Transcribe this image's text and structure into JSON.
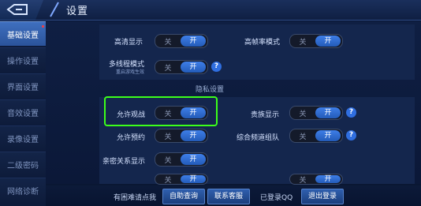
{
  "header": {
    "title": "设置"
  },
  "sidebar": {
    "items": [
      {
        "label": "基础设置",
        "active": true
      },
      {
        "label": "操作设置"
      },
      {
        "label": "界面设置"
      },
      {
        "label": "音效设置"
      },
      {
        "label": "录像设置"
      },
      {
        "label": "二级密码"
      },
      {
        "label": "网络诊断"
      }
    ]
  },
  "display": {
    "hd": {
      "label": "高清显示",
      "off": "关",
      "on": "开"
    },
    "hfr": {
      "label": "高帧率模式",
      "off": "关",
      "on": "开"
    },
    "multithread": {
      "label": "多线程模式",
      "sublabel": "重启游戏生效",
      "off": "关",
      "on": "开",
      "help": "?"
    }
  },
  "privacy": {
    "title": "隐私设置",
    "allow_spectate": {
      "label": "允许观战",
      "off": "关",
      "on": "开"
    },
    "noble_display": {
      "label": "贵族显示",
      "off": "关",
      "on": "开",
      "help": "?"
    },
    "allow_reserve": {
      "label": "允许预约",
      "off": "关",
      "on": "开"
    },
    "channel_team": {
      "label": "综合频道组队",
      "off": "关",
      "on": "开",
      "help": "?"
    },
    "relationship": {
      "label": "亲密关系显示",
      "off": "关",
      "on": "开"
    },
    "hidden1": {
      "off": "关",
      "on": "开"
    },
    "hidden2": {
      "off": "关",
      "on": "开"
    }
  },
  "footer": {
    "question": "有困难请点我",
    "self_check": "自助查询",
    "contact": "联系客服",
    "logged_in": "已登录QQ",
    "logout": "退出登录"
  },
  "colors": {
    "accent": "#2f6ee0",
    "highlight": "#3cff1a"
  }
}
